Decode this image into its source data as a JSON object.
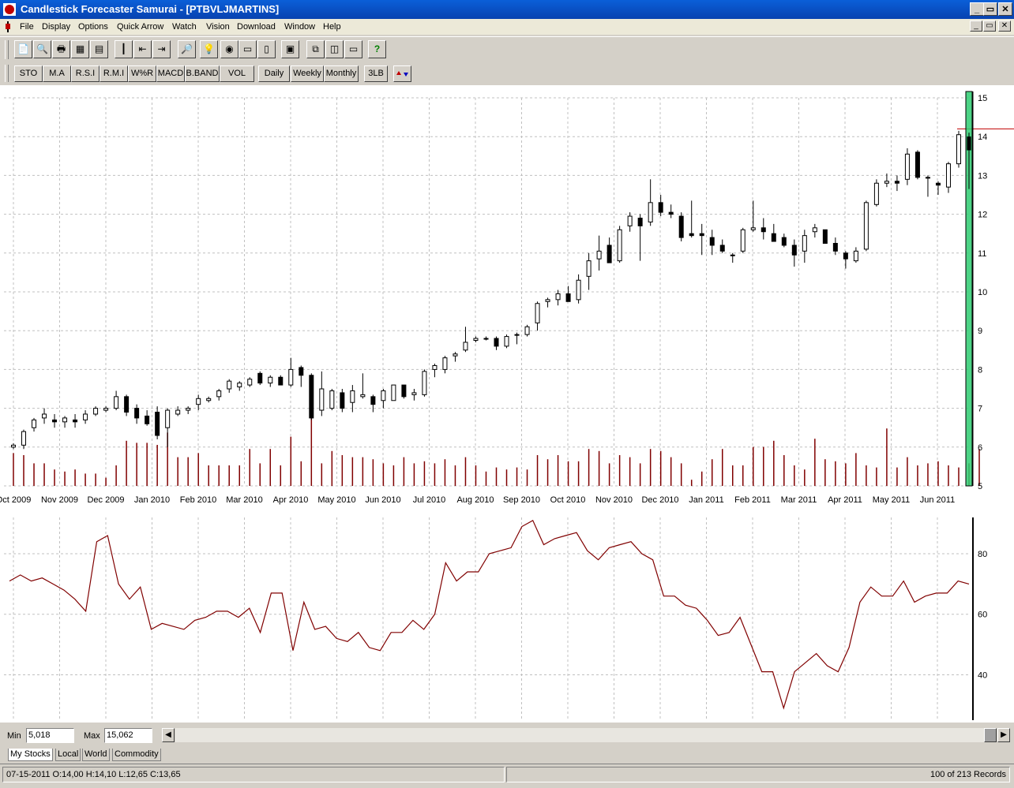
{
  "window": {
    "title": "Candlestick Forecaster Samurai - [PTBVLJMARTINS]",
    "minimize": "_",
    "maximize": "▭",
    "close": "✕"
  },
  "menu": [
    "File",
    "Display",
    "Options",
    "Quick Arrow",
    "Watch",
    "Vision",
    "Download",
    "Window",
    "Help"
  ],
  "toolbar_icons": [
    "open-icon",
    "print-preview-icon",
    "print-icon",
    "scan-icon",
    "table-icon",
    "candle-icon",
    "arrow-left-icon",
    "arrow-right-icon",
    "zoom-icon",
    "bulb-icon",
    "eye-icon",
    "monitor-icon",
    "notepad-icon",
    "portfolio-icon",
    "cascade-icon",
    "tile-vertical-icon",
    "tile-horizontal-icon",
    "help-icon"
  ],
  "indicator_buttons": [
    "STO",
    "M.A",
    "R.S.I",
    "R.M.I",
    "W%R",
    "MACD",
    "B.BAND",
    "VOL"
  ],
  "period_buttons": [
    "Daily",
    "Weekly",
    "Monthly"
  ],
  "extra_buttons": [
    "3LB"
  ],
  "minmax": {
    "min_label": "Min",
    "min_value": "5,018",
    "max_label": "Max",
    "max_value": "15,062"
  },
  "tabs": [
    "My Stocks",
    "Local",
    "World",
    "Commodity"
  ],
  "status": {
    "info": "07-15-2011 O:14,00 H:14,10 L:12,65 C:13,65",
    "records": "100 of    213 Records"
  },
  "colors": {
    "candle": "#000000",
    "volume": "#800000",
    "indicator": "#800000",
    "highlight": "#2ecc71",
    "grid": "#c0c0c0",
    "titlebar": "#0a5fd8"
  },
  "chart_data": [
    {
      "type": "candlestick",
      "title": "",
      "ylim": [
        5,
        15
      ],
      "y_ticks": [
        "5",
        "6",
        "7",
        "8",
        "9",
        "10",
        "11",
        "12",
        "13",
        "14",
        "15"
      ],
      "x_ticks": [
        "Oct 2009",
        "Nov 2009",
        "Dec 2009",
        "Jan 2010",
        "Feb 2010",
        "Mar 2010",
        "Apr 2010",
        "May 2010",
        "Jun 2010",
        "Jul 2010",
        "Aug 2010",
        "Sep 2010",
        "Oct 2010",
        "Nov 2010",
        "Dec 2010",
        "Jan 2011",
        "Feb 2011",
        "Mar 2011",
        "Apr 2011",
        "May 2011",
        "Jun 2011"
      ],
      "reference_line": 14.2,
      "candles": [
        [
          6.0,
          6.1,
          5.95,
          6.05
        ],
        [
          6.05,
          6.45,
          5.95,
          6.4
        ],
        [
          6.5,
          6.75,
          6.4,
          6.7
        ],
        [
          6.75,
          7.0,
          6.6,
          6.85
        ],
        [
          6.7,
          6.85,
          6.5,
          6.65
        ],
        [
          6.65,
          6.8,
          6.5,
          6.75
        ],
        [
          6.7,
          6.85,
          6.5,
          6.65
        ],
        [
          6.7,
          6.95,
          6.6,
          6.85
        ],
        [
          6.85,
          7.05,
          6.8,
          7.0
        ],
        [
          6.95,
          7.05,
          6.9,
          7.0
        ],
        [
          7.0,
          7.45,
          6.95,
          7.3
        ],
        [
          7.3,
          7.35,
          6.8,
          6.9
        ],
        [
          7.0,
          7.1,
          6.6,
          6.75
        ],
        [
          6.8,
          6.95,
          6.55,
          6.6
        ],
        [
          6.9,
          7.05,
          6.2,
          6.3
        ],
        [
          6.5,
          7.0,
          6.0,
          6.95
        ],
        [
          6.85,
          7.05,
          6.8,
          6.95
        ],
        [
          6.95,
          7.05,
          6.85,
          7.0
        ],
        [
          7.1,
          7.35,
          6.95,
          7.25
        ],
        [
          7.2,
          7.3,
          7.15,
          7.25
        ],
        [
          7.3,
          7.5,
          7.2,
          7.45
        ],
        [
          7.5,
          7.75,
          7.4,
          7.7
        ],
        [
          7.55,
          7.7,
          7.45,
          7.65
        ],
        [
          7.6,
          7.8,
          7.55,
          7.75
        ],
        [
          7.9,
          7.95,
          7.6,
          7.65
        ],
        [
          7.65,
          7.85,
          7.55,
          7.8
        ],
        [
          7.8,
          7.85,
          7.6,
          7.6
        ],
        [
          7.6,
          8.3,
          7.55,
          8.0
        ],
        [
          8.05,
          8.1,
          7.55,
          7.85
        ],
        [
          7.85,
          7.9,
          6.7,
          6.75
        ],
        [
          6.95,
          7.95,
          6.8,
          7.5
        ],
        [
          7.0,
          7.5,
          6.95,
          7.45
        ],
        [
          7.4,
          7.5,
          6.9,
          7.0
        ],
        [
          7.15,
          7.6,
          6.9,
          7.45
        ],
        [
          7.3,
          7.9,
          7.25,
          7.35
        ],
        [
          7.3,
          7.35,
          6.9,
          7.1
        ],
        [
          7.2,
          7.5,
          7.0,
          7.45
        ],
        [
          7.2,
          7.6,
          7.2,
          7.6
        ],
        [
          7.6,
          7.6,
          7.25,
          7.3
        ],
        [
          7.35,
          7.5,
          7.2,
          7.4
        ],
        [
          7.35,
          8.0,
          7.3,
          7.95
        ],
        [
          8.0,
          8.15,
          7.8,
          8.1
        ],
        [
          8.0,
          8.35,
          7.9,
          8.3
        ],
        [
          8.35,
          8.45,
          8.2,
          8.4
        ],
        [
          8.5,
          9.1,
          8.45,
          8.7
        ],
        [
          8.75,
          8.85,
          8.7,
          8.8
        ],
        [
          8.8,
          8.85,
          8.75,
          8.8
        ],
        [
          8.8,
          8.85,
          8.5,
          8.6
        ],
        [
          8.6,
          8.9,
          8.55,
          8.85
        ],
        [
          8.9,
          8.95,
          8.65,
          8.9
        ],
        [
          8.9,
          9.15,
          8.85,
          9.1
        ],
        [
          9.2,
          9.75,
          9.0,
          9.7
        ],
        [
          9.75,
          9.85,
          9.6,
          9.8
        ],
        [
          9.8,
          10.05,
          9.65,
          9.95
        ],
        [
          9.95,
          10.15,
          9.75,
          9.75
        ],
        [
          9.8,
          10.45,
          9.7,
          10.3
        ],
        [
          10.4,
          11.0,
          10.05,
          10.8
        ],
        [
          10.85,
          11.45,
          10.55,
          11.05
        ],
        [
          11.2,
          11.4,
          10.8,
          10.75
        ],
        [
          10.8,
          11.7,
          10.75,
          11.6
        ],
        [
          11.7,
          12.05,
          11.55,
          11.95
        ],
        [
          11.9,
          12.0,
          10.8,
          11.7
        ],
        [
          11.8,
          12.9,
          11.7,
          12.3
        ],
        [
          12.3,
          12.5,
          11.95,
          12.05
        ],
        [
          12.05,
          12.25,
          11.9,
          12.0
        ],
        [
          11.95,
          12.05,
          11.3,
          11.4
        ],
        [
          11.5,
          12.35,
          11.4,
          11.45
        ],
        [
          11.5,
          11.75,
          10.95,
          11.45
        ],
        [
          11.4,
          11.6,
          10.95,
          11.2
        ],
        [
          11.2,
          11.35,
          11.0,
          11.05
        ],
        [
          10.95,
          11.0,
          10.75,
          10.95
        ],
        [
          11.05,
          11.65,
          11.0,
          11.6
        ],
        [
          11.6,
          12.35,
          11.55,
          11.65
        ],
        [
          11.65,
          11.9,
          11.35,
          11.55
        ],
        [
          11.5,
          11.75,
          11.3,
          11.3
        ],
        [
          11.4,
          11.5,
          11.15,
          11.2
        ],
        [
          11.2,
          11.35,
          10.65,
          10.95
        ],
        [
          11.05,
          11.6,
          10.75,
          11.45
        ],
        [
          11.55,
          11.75,
          11.4,
          11.65
        ],
        [
          11.6,
          11.6,
          11.25,
          11.25
        ],
        [
          11.25,
          11.4,
          10.95,
          11.05
        ],
        [
          11.0,
          11.05,
          10.6,
          10.85
        ],
        [
          10.8,
          11.15,
          10.75,
          11.05
        ],
        [
          11.1,
          12.35,
          11.05,
          12.3
        ],
        [
          12.25,
          12.9,
          12.2,
          12.8
        ],
        [
          12.8,
          13.05,
          12.7,
          12.85
        ],
        [
          12.85,
          13.0,
          12.6,
          12.8
        ],
        [
          12.9,
          13.7,
          12.75,
          13.55
        ],
        [
          13.6,
          13.65,
          12.9,
          12.95
        ],
        [
          12.95,
          13.0,
          12.45,
          12.95
        ],
        [
          12.8,
          12.85,
          12.5,
          12.75
        ],
        [
          12.7,
          13.35,
          12.55,
          13.3
        ],
        [
          13.3,
          14.15,
          13.2,
          14.05
        ],
        [
          14.0,
          14.1,
          12.65,
          13.65
        ]
      ],
      "volume_label": "VOL",
      "volume": [
        0.8,
        0.75,
        0.55,
        0.55,
        0.4,
        0.35,
        0.4,
        0.3,
        0.3,
        0.2,
        0.5,
        1.1,
        1.05,
        1.05,
        1.0,
        1.3,
        0.7,
        0.7,
        0.8,
        0.5,
        0.5,
        0.5,
        0.5,
        0.9,
        0.55,
        0.9,
        0.5,
        1.2,
        0.6,
        1.7,
        0.55,
        0.85,
        0.75,
        0.7,
        0.7,
        0.65,
        0.55,
        0.5,
        0.7,
        0.55,
        0.6,
        0.55,
        0.65,
        0.5,
        0.7,
        0.5,
        0.35,
        0.45,
        0.4,
        0.45,
        0.4,
        0.75,
        0.65,
        0.75,
        0.6,
        0.6,
        0.9,
        0.85,
        0.55,
        0.75,
        0.7,
        0.55,
        0.9,
        0.85,
        0.7,
        0.55,
        0.15,
        0.35,
        0.65,
        0.9,
        0.5,
        0.5,
        0.95,
        0.95,
        1.1,
        0.75,
        0.5,
        0.4,
        1.15,
        0.65,
        0.6,
        0.55,
        0.8,
        0.5,
        0.45,
        1.4,
        0.45,
        0.7,
        0.5,
        0.55,
        0.6,
        0.5,
        0.45,
        0.55,
        0.9
      ]
    },
    {
      "type": "line",
      "title": "",
      "ylim": [
        25,
        92
      ],
      "y_ticks": [
        "40",
        "60",
        "80"
      ],
      "values": [
        71,
        73,
        71,
        72,
        70,
        68,
        65,
        61,
        84,
        86,
        70,
        65,
        69,
        55,
        57,
        56,
        55,
        58,
        59,
        61,
        61,
        59,
        62,
        54,
        67,
        67,
        48,
        64,
        55,
        56,
        52,
        51,
        54,
        49,
        48,
        54,
        54,
        58,
        55,
        60,
        77,
        71,
        74,
        74,
        80,
        81,
        82,
        89,
        91,
        83,
        85,
        86,
        87,
        81,
        78,
        82,
        83,
        84,
        80,
        78,
        66,
        66,
        63,
        62,
        58,
        53,
        54,
        59,
        50,
        41,
        41,
        29,
        41,
        44,
        47,
        43,
        41,
        49,
        64,
        69,
        66,
        66,
        71,
        64,
        66,
        67,
        67,
        71,
        70
      ]
    }
  ]
}
